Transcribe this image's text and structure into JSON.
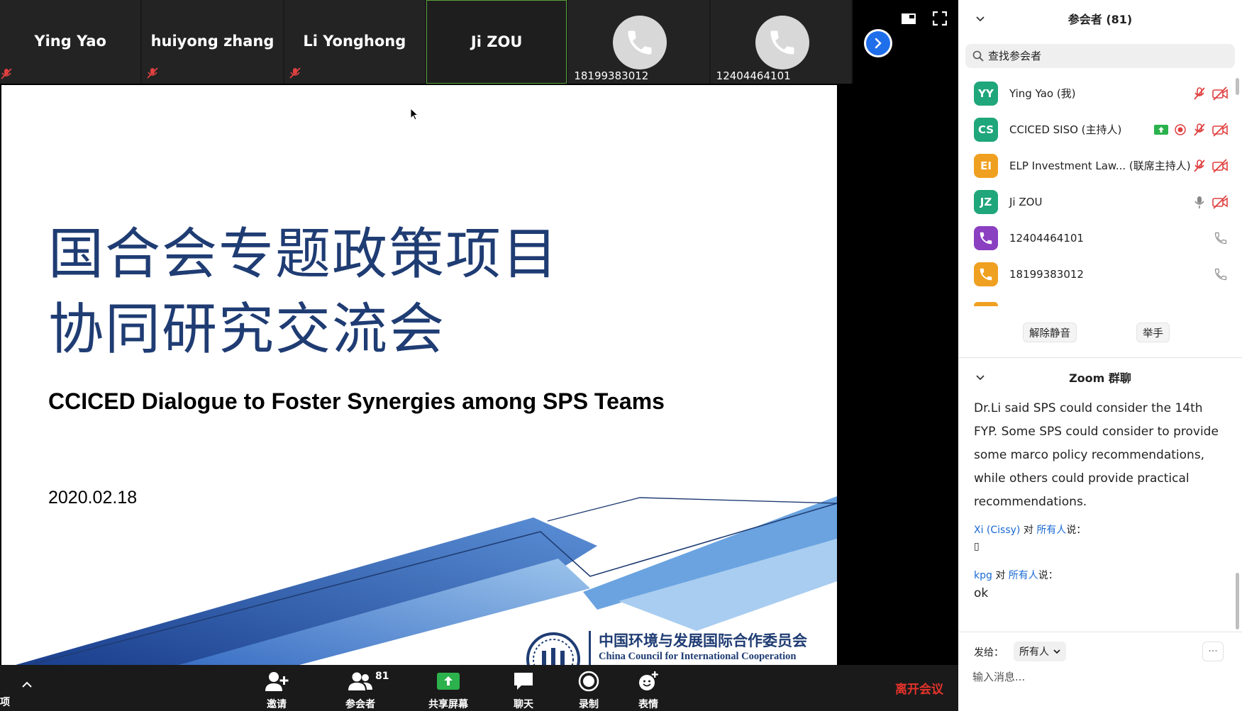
{
  "video_strip": {
    "tiles": [
      {
        "name": "Ying Yao",
        "muted": false
      },
      {
        "name": "huiyong zhang",
        "muted": true
      },
      {
        "name": "Li Yonghong",
        "muted": true
      },
      {
        "name": "Ji ZOU",
        "muted": false,
        "active": true
      },
      {
        "number": "18199383012",
        "phone": true
      },
      {
        "number": "12404464101",
        "phone": true
      }
    ]
  },
  "slide": {
    "title_line1": "国合会专题政策项目",
    "title_line2": "协同研究交流会",
    "subtitle": "CCICED Dialogue to Foster Synergies among SPS Teams",
    "date": "2020.02.18",
    "org_name_cn": "中国环境与发展国际合作委员会",
    "org_name_en": "China Council for International Cooperation"
  },
  "toolbar": {
    "left_label": "项",
    "invite": "邀请",
    "participants": "参会者",
    "participant_count": "81",
    "share_screen": "共享屏幕",
    "chat": "聊天",
    "record": "录制",
    "reactions": "表情",
    "leave": "离开会议"
  },
  "panel": {
    "participants_header": "参会者 (81)",
    "search_placeholder": "查找参会者",
    "participants": [
      {
        "initials": "YY",
        "name": "Ying Yao (我)",
        "color": "#1fa67a"
      },
      {
        "initials": "CS",
        "name": "CCICED SISO (主持人)",
        "color": "#1fa67a"
      },
      {
        "initials": "EI",
        "name": "ELP Investment Law... (联席主持人)",
        "color": "#f0a020"
      },
      {
        "initials": "JZ",
        "name": "Ji ZOU",
        "color": "#1fa67a"
      },
      {
        "initials": "",
        "name": "12404464101",
        "color": "#8b3fc1"
      },
      {
        "initials": "",
        "name": "18199383012",
        "color": "#f0a020"
      }
    ],
    "unmute_all": "解除静音",
    "raise_hand": "举手",
    "chat_header": "Zoom 群聊",
    "chat_message_text": "Dr.Li said SPS could consider the 14th FYP. Some SPS could consider to provide some marco policy recommendations, while others could provide practical recommendations.",
    "chat_msg2_sender": "Xi (Cissy)",
    "chat_msg2_to_word": "对",
    "chat_msg2_recipient": "所有人",
    "chat_msg2_suffix": "说：",
    "chat_msg2_text": "▯",
    "chat_msg3_sender": "kpg",
    "chat_msg3_to_word": "对",
    "chat_msg3_recipient": "所有人",
    "chat_msg3_suffix": "说：",
    "chat_msg3_text": "ok",
    "send_to_label": "发给：",
    "send_to_value": "所有人",
    "more_label": "···",
    "input_placeholder": "输入消息..."
  }
}
